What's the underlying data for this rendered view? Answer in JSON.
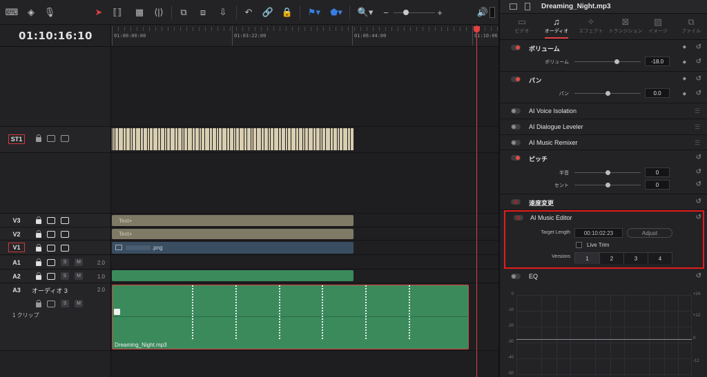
{
  "timeline": {
    "timecode": "01:10:16:10",
    "ruler_labels": [
      "01:00:00:00",
      "01:03:22:00",
      "01:06:44:00",
      "01:10:06:"
    ],
    "tracks": {
      "st1": {
        "name": "ST1"
      },
      "v3": {
        "name": "V3",
        "clip": "Text+"
      },
      "v2": {
        "name": "V2",
        "clip": "Text+"
      },
      "v1": {
        "name": "V1",
        "clip": ".png"
      },
      "a1": {
        "name": "A1",
        "level": "2.0",
        "s": "S",
        "m": "M"
      },
      "a2": {
        "name": "A2",
        "level": "1.0",
        "s": "S",
        "m": "M"
      },
      "a3": {
        "name": "A3",
        "label": "オーディオ 3",
        "level": "2.0",
        "s": "S",
        "m": "M",
        "clip_count": "1 クリップ",
        "clip": "Dreaming_Night.mp3"
      }
    }
  },
  "inspector": {
    "file_name": "Dreaming_Night.mp3",
    "tabs": [
      {
        "label": "ビデオ",
        "icon": "video-icon",
        "active": false
      },
      {
        "label": "オーディオ",
        "icon": "audio-icon",
        "active": true
      },
      {
        "label": "エフェクト",
        "icon": "effects-icon",
        "active": false
      },
      {
        "label": "トランジション",
        "icon": "transition-icon",
        "active": false
      },
      {
        "label": "イメージ",
        "icon": "image-icon",
        "active": false
      },
      {
        "label": "ファイル",
        "icon": "file-icon",
        "active": false
      }
    ],
    "volume": {
      "title": "ボリューム",
      "param": "ボリューム",
      "value": "-18.0"
    },
    "pan": {
      "title": "パン",
      "param": "パン",
      "value": "0.0"
    },
    "ai_voice_isolation": "AI Voice Isolation",
    "ai_dialogue_leveler": "AI Dialogue Leveler",
    "ai_music_remixer": "AI Music Remixer",
    "pitch": {
      "title": "ピッチ",
      "semitone_label": "半音",
      "semitone_value": "0",
      "cent_label": "セント",
      "cent_value": "0"
    },
    "speed_change": "速度変更",
    "ai_music_editor": {
      "title": "AI Music Editor",
      "target_length_label": "Target Length",
      "target_length_value": "00:10:02:23",
      "adjust_label": "Adjust",
      "live_trim_label": "Live Trim",
      "versions_label": "Versions",
      "versions": [
        "1",
        "2",
        "3",
        "4"
      ],
      "active_version": "1"
    },
    "eq": {
      "title": "EQ",
      "left_scale": [
        "0",
        "-10",
        "-20",
        "-30",
        "-40",
        "-50"
      ],
      "right_scale": [
        "+24",
        "+12",
        "0",
        "-12"
      ]
    }
  },
  "colors": {
    "accent": "#e14040",
    "highlight_box": "#e41c1c",
    "audio_clip": "#3a8a5c",
    "text_clip": "#7f7a66",
    "image_clip": "#3a4e61"
  }
}
